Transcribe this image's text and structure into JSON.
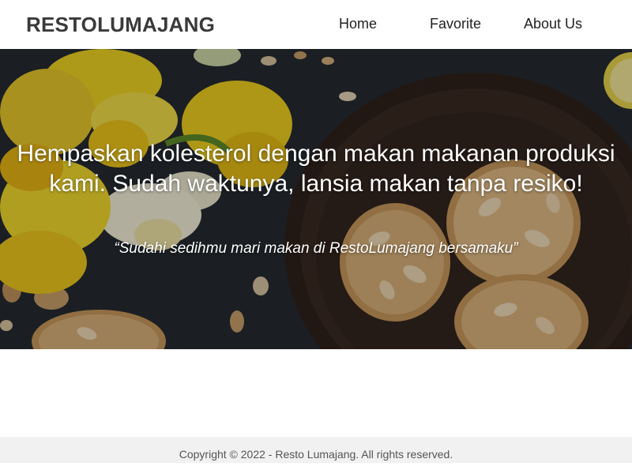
{
  "brand": {
    "name": "RESTOLUMAJANG"
  },
  "nav": {
    "items": [
      {
        "label": "Home"
      },
      {
        "label": "Favorite"
      },
      {
        "label": "About Us"
      }
    ]
  },
  "hero": {
    "title": "Hempaskan kolesterol dengan makan makanan produksi kami. Sudah waktunya, lansia makan tanpa resiko!",
    "quote": "“Sudahi sedihmu mari makan di RestoLumajang bersamaku”",
    "image_subject": "almond cookies in a dark bowl with yellow daffodils"
  },
  "footer": {
    "copyright": "Copyright © 2022 - Resto Lumajang. All rights reserved."
  },
  "colors": {
    "brand_text": "#3a3a3a",
    "hero_text": "#ffffff",
    "footer_bg": "#f1f1f1",
    "footer_text": "#555555"
  }
}
